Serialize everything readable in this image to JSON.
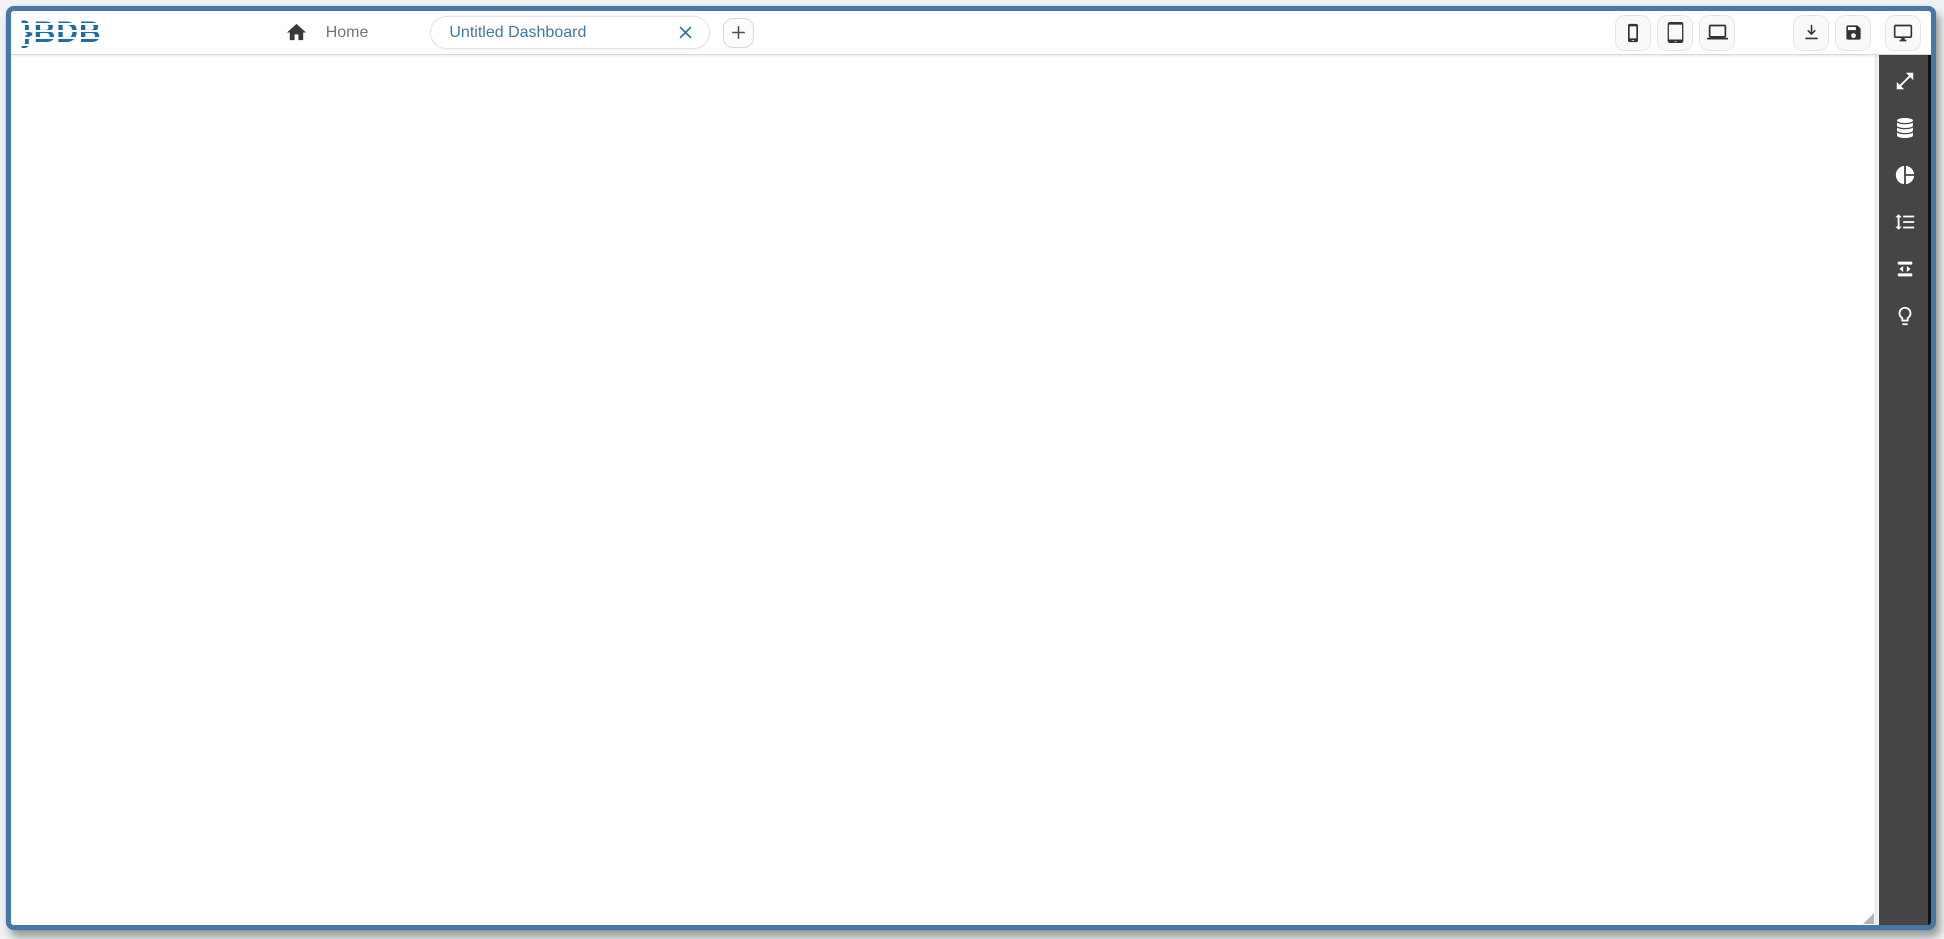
{
  "window": {
    "colors": {
      "frame_border": "#4577A7",
      "accent_blue": "#1B6CA8",
      "sidebar_background": "#454545",
      "tab_text": "#4077A5",
      "topbar_background": "#FFFFFF",
      "canvas_background": "#FFFFFF"
    }
  },
  "app": {
    "logo": "BDB"
  },
  "topbar": {
    "home": {
      "icon": "home-icon",
      "label": "Home"
    },
    "tabs": [
      {
        "title": "Untitled Dashboard",
        "close_icon": "close-icon",
        "selected": true
      }
    ],
    "add_tab": {
      "icon": "plus-icon"
    },
    "device_preview_buttons": [
      {
        "icon": "mobile-icon"
      },
      {
        "icon": "tablet-icon"
      },
      {
        "icon": "laptop-icon"
      }
    ],
    "action_buttons": [
      {
        "icon": "download-icon"
      },
      {
        "icon": "save-icon"
      },
      {
        "icon": "desktop-monitor-icon"
      }
    ]
  },
  "canvas": {
    "content": ""
  },
  "right_sidebar": {
    "items": [
      {
        "icon": "expand-diagonal-icon"
      },
      {
        "icon": "database-icon"
      },
      {
        "icon": "pie-chart-icon"
      },
      {
        "icon": "line-spacing-icon"
      },
      {
        "icon": "swap-horizontal-icon"
      },
      {
        "icon": "lightbulb-icon"
      }
    ]
  }
}
